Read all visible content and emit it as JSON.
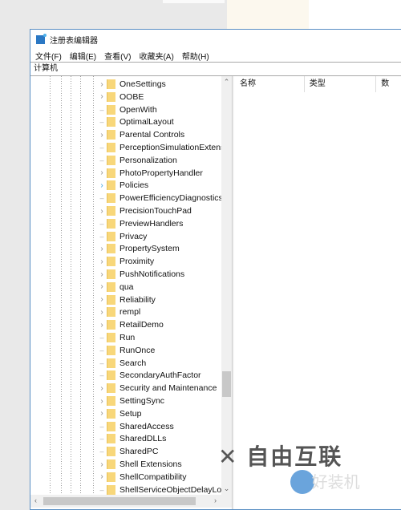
{
  "window": {
    "title": "注册表编辑器",
    "icon": "regedit-icon"
  },
  "menu": [
    "文件(F)",
    "编辑(E)",
    "查看(V)",
    "收藏夹(A)",
    "帮助(H)"
  ],
  "address": "计算机",
  "tree": [
    {
      "label": "OneSettings",
      "expandable": true
    },
    {
      "label": "OOBE",
      "expandable": true
    },
    {
      "label": "OpenWith",
      "expandable": false
    },
    {
      "label": "OptimalLayout",
      "expandable": false
    },
    {
      "label": "Parental Controls",
      "expandable": true
    },
    {
      "label": "PerceptionSimulationExtens",
      "expandable": false
    },
    {
      "label": "Personalization",
      "expandable": false
    },
    {
      "label": "PhotoPropertyHandler",
      "expandable": true
    },
    {
      "label": "Policies",
      "expandable": true,
      "hover": true
    },
    {
      "label": "PowerEfficiencyDiagnostics",
      "expandable": false
    },
    {
      "label": "PrecisionTouchPad",
      "expandable": true
    },
    {
      "label": "PreviewHandlers",
      "expandable": false
    },
    {
      "label": "Privacy",
      "expandable": false
    },
    {
      "label": "PropertySystem",
      "expandable": true
    },
    {
      "label": "Proximity",
      "expandable": true
    },
    {
      "label": "PushNotifications",
      "expandable": true
    },
    {
      "label": "qua",
      "expandable": true
    },
    {
      "label": "Reliability",
      "expandable": true
    },
    {
      "label": "rempl",
      "expandable": true
    },
    {
      "label": "RetailDemo",
      "expandable": true
    },
    {
      "label": "Run",
      "expandable": false
    },
    {
      "label": "RunOnce",
      "expandable": false
    },
    {
      "label": "Search",
      "expandable": false
    },
    {
      "label": "SecondaryAuthFactor",
      "expandable": false
    },
    {
      "label": "Security and Maintenance",
      "expandable": true
    },
    {
      "label": "SettingSync",
      "expandable": true
    },
    {
      "label": "Setup",
      "expandable": true
    },
    {
      "label": "SharedAccess",
      "expandable": false
    },
    {
      "label": "SharedDLLs",
      "expandable": false
    },
    {
      "label": "SharedPC",
      "expandable": false
    },
    {
      "label": "Shell Extensions",
      "expandable": true
    },
    {
      "label": "ShellCompatibility",
      "expandable": true
    },
    {
      "label": "ShellServiceObjectDelayLoa",
      "expandable": false
    }
  ],
  "columns": [
    "名称",
    "类型",
    "数"
  ],
  "watermark": {
    "brand": "自由互联",
    "sub": "好装机"
  }
}
